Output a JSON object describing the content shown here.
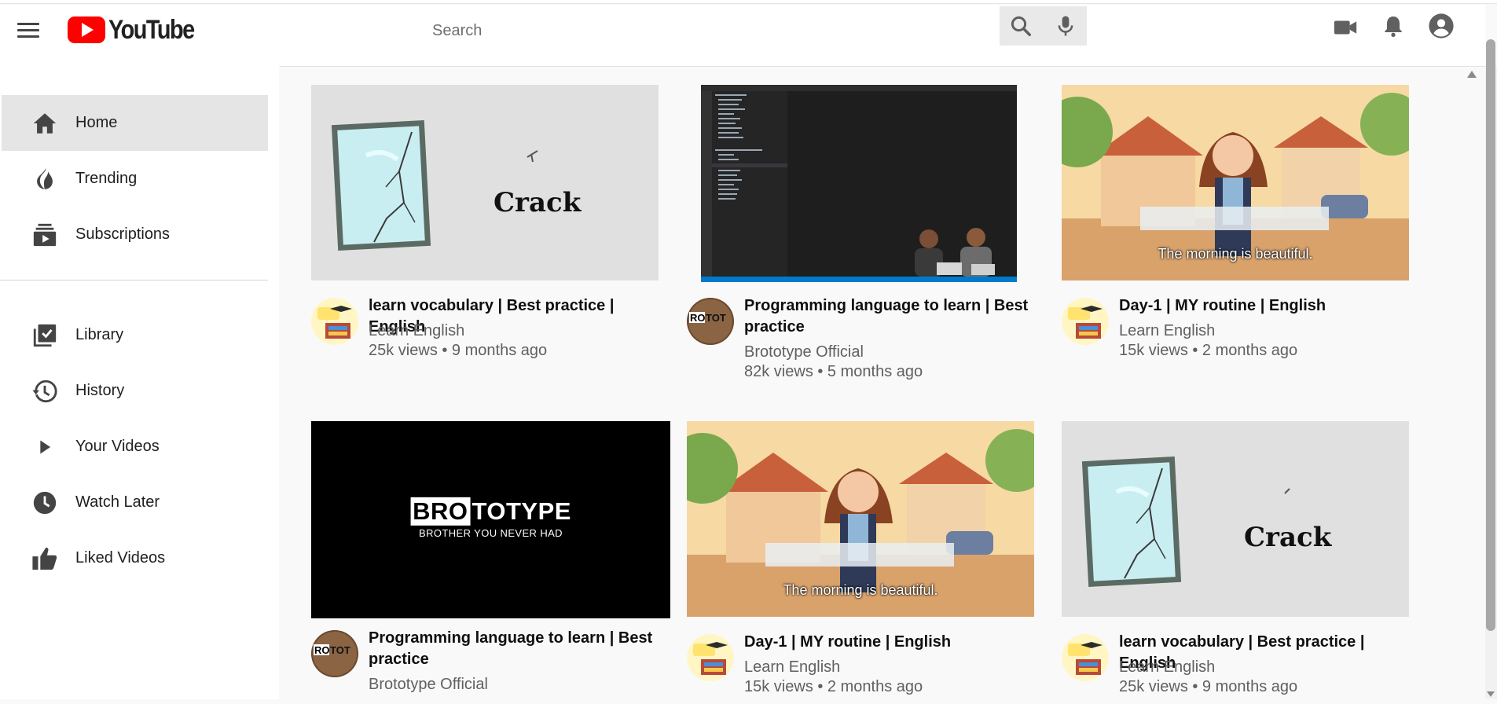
{
  "header": {
    "logo_text": "YouTube",
    "search_placeholder": "Search"
  },
  "sidebar": {
    "items": [
      {
        "label": "Home",
        "icon": "home-icon",
        "active": true
      },
      {
        "label": "Trending",
        "icon": "fire-icon"
      },
      {
        "label": "Subscriptions",
        "icon": "subscriptions-icon"
      },
      {
        "label": "Library",
        "icon": "library-icon"
      },
      {
        "label": "History",
        "icon": "history-icon"
      },
      {
        "label": "Your Videos",
        "icon": "play-icon"
      },
      {
        "label": "Watch Later",
        "icon": "clock-icon"
      },
      {
        "label": "Liked Videos",
        "icon": "thumbs-up-icon"
      }
    ]
  },
  "videos": [
    {
      "title_line1": "learn vocabulary | Best practice | English",
      "title_line2": "",
      "channel": "Learn English",
      "meta": "25k views • 9 months ago",
      "thumb_text": "Crack",
      "avatar": "learn-english-avatar"
    },
    {
      "title_line1": "Programming language to learn | Best",
      "title_line2": "practice",
      "channel": "Brototype Official",
      "meta": "82k views • 5 months ago",
      "avatar": "brototype-avatar"
    },
    {
      "title_line1": "Day-1 | MY routine | English",
      "title_line2": "",
      "channel": "Learn English",
      "meta": "15k views • 2 months ago",
      "thumb_text": "The morning is beautiful.",
      "avatar": "learn-english-avatar"
    },
    {
      "title_line1": "Programming language to learn | Best",
      "title_line2": "practice",
      "channel": "Brototype Official",
      "meta": "",
      "thumb_brand": "TOTYPE",
      "thumb_brand_box": "BRO",
      "thumb_tagline": "BROTHER YOU NEVER HAD",
      "avatar": "brototype-avatar"
    },
    {
      "title_line1": "Day-1 | MY routine | English",
      "title_line2": "",
      "channel": "Learn English",
      "meta": "15k views • 2 months ago",
      "thumb_text": "The morning is beautiful.",
      "avatar": "learn-english-avatar"
    },
    {
      "title_line1": "learn vocabulary | Best practice | English",
      "title_line2": "",
      "channel": "Learn English",
      "meta": "25k views • 9 months ago",
      "thumb_text": "Crack",
      "avatar": "learn-english-avatar"
    }
  ],
  "colors": {
    "brand_red": "#ff0000",
    "sidebar_active": "#e5e5e5",
    "meta_text": "#606060"
  }
}
